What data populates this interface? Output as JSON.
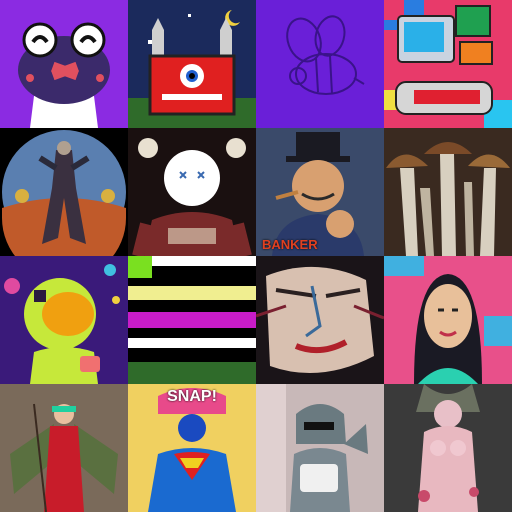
{
  "tiles": [
    {
      "name": "frog-mask",
      "text": ""
    },
    {
      "name": "pixel-castle-eye",
      "text": ""
    },
    {
      "name": "purple-bee-sketch",
      "text": ""
    },
    {
      "name": "retro-computer",
      "text": ""
    },
    {
      "name": "armored-warrior-round",
      "text": ""
    },
    {
      "name": "skull-tshirt-character",
      "text": ""
    },
    {
      "name": "banker-character",
      "text": "BANKER"
    },
    {
      "name": "mushrooms",
      "text": ""
    },
    {
      "name": "space-astronaut",
      "text": ""
    },
    {
      "name": "color-stripes",
      "text": ""
    },
    {
      "name": "distorted-face",
      "text": ""
    },
    {
      "name": "woman-portrait",
      "text": ""
    },
    {
      "name": "winged-woman",
      "text": ""
    },
    {
      "name": "comic-superhero",
      "text": "SNAP!"
    },
    {
      "name": "dinosaur-hoodie",
      "text": ""
    },
    {
      "name": "pink-sculpture",
      "text": ""
    }
  ]
}
